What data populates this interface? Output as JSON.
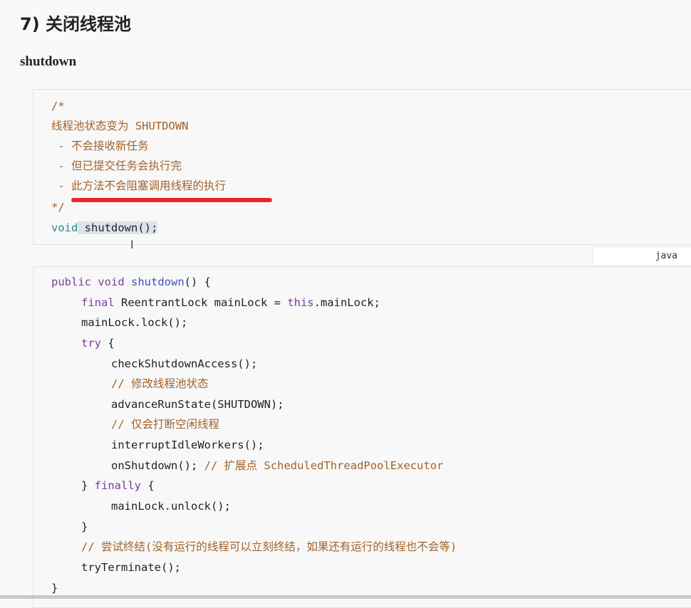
{
  "page": {
    "title": "7) 关闭线程池",
    "section": "shutdown",
    "lang_label": "java"
  },
  "block1": {
    "lines": [
      "/*",
      "线程池状态变为 SHUTDOWN",
      " - 不会接收新任务",
      " - 但已提交任务会执行完",
      " - 此方法不会阻塞调用线程的执行",
      "*/"
    ],
    "sig_kw": "void",
    "sig_rest": " shutdown();"
  },
  "block2": {
    "l1_kw": "public void",
    "l1_fn": "shutdown",
    "l1_rest": "() {",
    "l2_kw": "final",
    "l2_a": " ReentrantLock mainLock = ",
    "l2_this": "this",
    "l2_b": ".mainLock;",
    "l3": "mainLock.lock();",
    "l4_kw": "try",
    "l4_rest": " {",
    "l5": "checkShutdownAccess();",
    "l6": "// 修改线程池状态",
    "l7": "advanceRunState(SHUTDOWN);",
    "l8": "// 仅会打断空闲线程",
    "l9": "interruptIdleWorkers();",
    "l10_code": "onShutdown(); ",
    "l10_comment": "// 扩展点 ScheduledThreadPoolExecutor",
    "l11_a": "} ",
    "l11_kw": "finally",
    "l11_b": " {",
    "l12": "mainLock.unlock();",
    "l13": "}",
    "l14": "// 尝试终结(没有运行的线程可以立刻终结，如果还有运行的线程也不会等)",
    "l15": "tryTerminate();",
    "l16": "}"
  }
}
